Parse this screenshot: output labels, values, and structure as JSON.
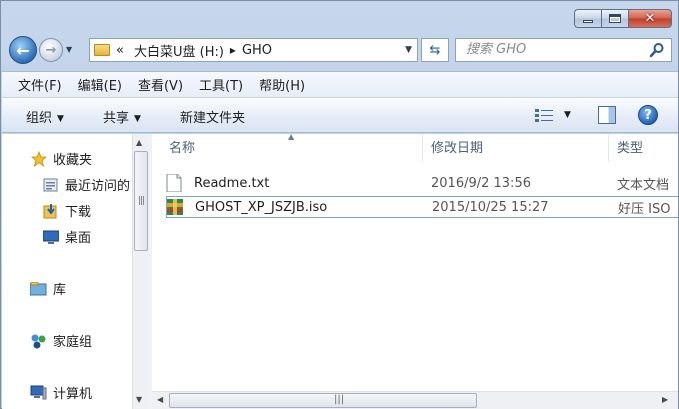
{
  "window": {
    "caption_buttons": [
      "minimize",
      "maximize",
      "close"
    ]
  },
  "address_bar": {
    "overflow": "«",
    "crumbs": [
      "大白菜U盘 (H:)",
      "GHO"
    ]
  },
  "search": {
    "placeholder": "搜索 GHO"
  },
  "menu": [
    "文件(F)",
    "编辑(E)",
    "查看(V)",
    "工具(T)",
    "帮助(H)"
  ],
  "toolbar": {
    "organize": "组织",
    "share": "共享",
    "new_folder": "新建文件夹"
  },
  "nav": {
    "favorites": "收藏夹",
    "recent": "最近访问的",
    "downloads": "下载",
    "desktop": "桌面",
    "libraries": "库",
    "homegroup": "家庭组",
    "computer": "计算机"
  },
  "columns": {
    "name": "名称",
    "date": "修改日期",
    "type": "类型"
  },
  "files": [
    {
      "name": "Readme.txt",
      "date": "2016/9/2 13:56",
      "type": "文本文档",
      "icon": "text-file-icon"
    },
    {
      "name": "GHOST_XP_JSZJB.iso",
      "date": "2015/10/25 15:27",
      "type": "好压 ISO",
      "icon": "iso-archive-icon"
    }
  ],
  "scrollbar": {
    "grip": "|||"
  }
}
